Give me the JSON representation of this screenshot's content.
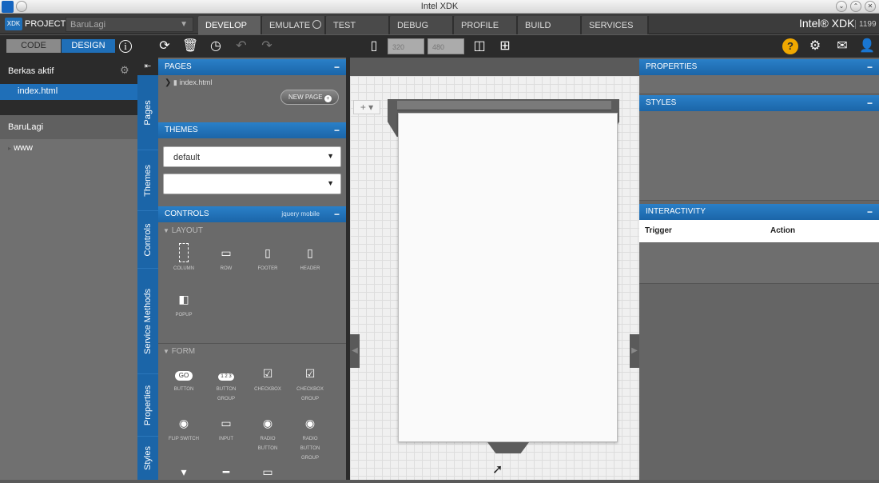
{
  "window": {
    "title": "Intel XDK"
  },
  "topbar": {
    "logo": "XDK",
    "projects_label": "PROJECTS",
    "project_name": "BaruLagi",
    "tabs": [
      "DEVELOP",
      "EMULATE",
      "TEST",
      "DEBUG",
      "PROFILE",
      "BUILD",
      "SERVICES"
    ],
    "active_tab": "DEVELOP",
    "brand": "Intel® XDK",
    "version": "1199"
  },
  "toolbar": {
    "code_label": "CODE",
    "design_label": "DESIGN",
    "width_value": "320",
    "height_value": "480"
  },
  "left": {
    "active_files_header": "Berkas aktif",
    "active_file": "index.html",
    "project_header": "BaruLagi",
    "folder": "www"
  },
  "vtabs": [
    "Pages",
    "Themes",
    "Controls",
    "Service Methods",
    "Properties",
    "Styles"
  ],
  "pages": {
    "header": "PAGES",
    "page_item": "index.html",
    "new_page_label": "NEW PAGE"
  },
  "themes": {
    "header": "THEMES",
    "select1": "default",
    "select2": ""
  },
  "controls": {
    "header": "CONTROLS",
    "framework": "jquery mobile",
    "layout_header": "LAYOUT",
    "layout_items": [
      "COLUMN",
      "ROW",
      "FOOTER",
      "HEADER",
      "POPUP"
    ],
    "form_header": "FORM",
    "form_items": [
      {
        "label": "BUTTON",
        "label2": ""
      },
      {
        "label": "BUTTON",
        "label2": "GROUP"
      },
      {
        "label": "CHECKBOX",
        "label2": ""
      },
      {
        "label": "CHECKBOX",
        "label2": "GROUP"
      },
      {
        "label": "FLIP SWITCH",
        "label2": ""
      },
      {
        "label": "INPUT",
        "label2": ""
      },
      {
        "label": "RADIO",
        "label2": "BUTTON"
      },
      {
        "label": "RADIO",
        "label2": "BUTTON GROUP"
      }
    ],
    "go_label": "GO",
    "button_group_label": "1 2 3"
  },
  "right": {
    "properties_header": "PROPERTIES",
    "styles_header": "STYLES",
    "interactivity_header": "INTERACTIVITY",
    "col_trigger": "Trigger",
    "col_action": "Action"
  }
}
